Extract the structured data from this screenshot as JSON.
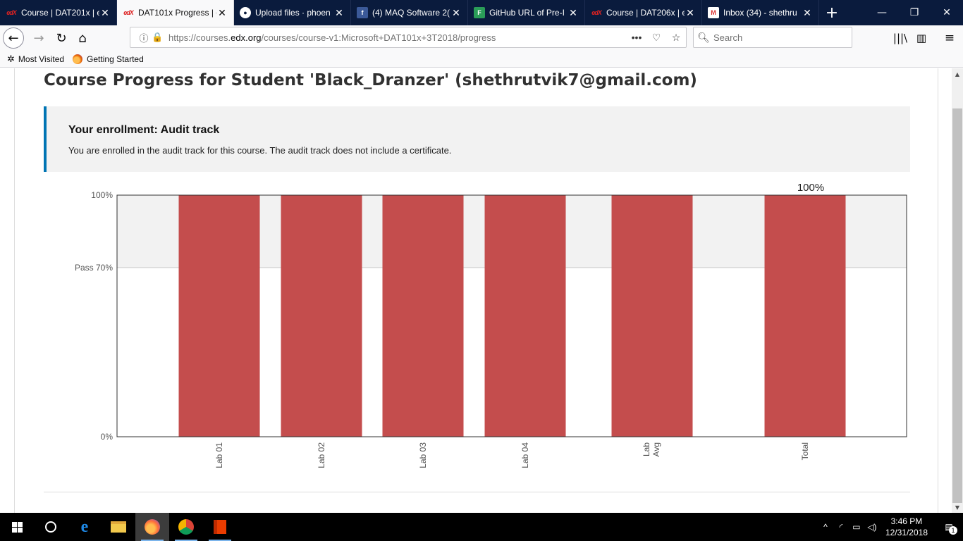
{
  "browser": {
    "tabs": [
      {
        "label": "Course | DAT201x | e",
        "icon": "edx-icon",
        "active": false
      },
      {
        "label": "DAT101x Progress | e",
        "icon": "edx-icon",
        "active": true
      },
      {
        "label": "Upload files · phoen",
        "icon": "github-icon",
        "active": false
      },
      {
        "label": "(4) MAQ Software 2(",
        "icon": "facebook-icon",
        "active": false
      },
      {
        "label": "GitHub URL of Pre-I",
        "icon": "forms-icon",
        "active": false
      },
      {
        "label": "Course | DAT206x | e",
        "icon": "edx-icon",
        "active": false
      },
      {
        "label": "Inbox (34) - shethru",
        "icon": "gmail-icon",
        "active": false
      }
    ],
    "url_prefix": "https://courses.",
    "url_domain": "edx.org",
    "url_path": "/courses/course-v1:Microsoft+DAT101x+3T2018/progress",
    "search_placeholder": "Search",
    "bookmarks": [
      {
        "label": "Most Visited",
        "icon": "gear-icon"
      },
      {
        "label": "Getting Started",
        "icon": "firefox-icon"
      }
    ]
  },
  "page": {
    "title": "Course Progress for Student 'Black_Dranzer' (shethrutvik7@gmail.com)",
    "enrollment_title": "Your enrollment: Audit track",
    "enrollment_text": "You are enrolled in the audit track for this course. The audit track does not include a certificate."
  },
  "chart_data": {
    "type": "bar",
    "categories": [
      "Lab 01",
      "Lab 02",
      "Lab 03",
      "Lab 04",
      "Lab Avg",
      "Total"
    ],
    "values": [
      100,
      100,
      100,
      100,
      100,
      100
    ],
    "ylim": [
      0,
      100
    ],
    "yticks": [
      {
        "value": 0,
        "label": "0%"
      },
      {
        "value": 70,
        "label": "Pass 70%"
      },
      {
        "value": 100,
        "label": "100%"
      }
    ],
    "pass_threshold": 70,
    "total_label": "100%",
    "bar_color": "#c44d4d",
    "pass_band_color": "#f2f2f2"
  },
  "taskbar": {
    "apps": [
      {
        "name": "start-button",
        "icon": "windows-icon"
      },
      {
        "name": "cortana-button",
        "icon": "circle-icon"
      },
      {
        "name": "edge-button",
        "icon": "edge-icon"
      },
      {
        "name": "file-explorer-button",
        "icon": "folder-icon"
      },
      {
        "name": "firefox-button",
        "icon": "firefox-icon"
      },
      {
        "name": "chrome-button",
        "icon": "chrome-icon"
      },
      {
        "name": "office-button",
        "icon": "office-icon"
      }
    ],
    "time": "3:46 PM",
    "date": "12/31/2018",
    "notification_count": "1"
  }
}
